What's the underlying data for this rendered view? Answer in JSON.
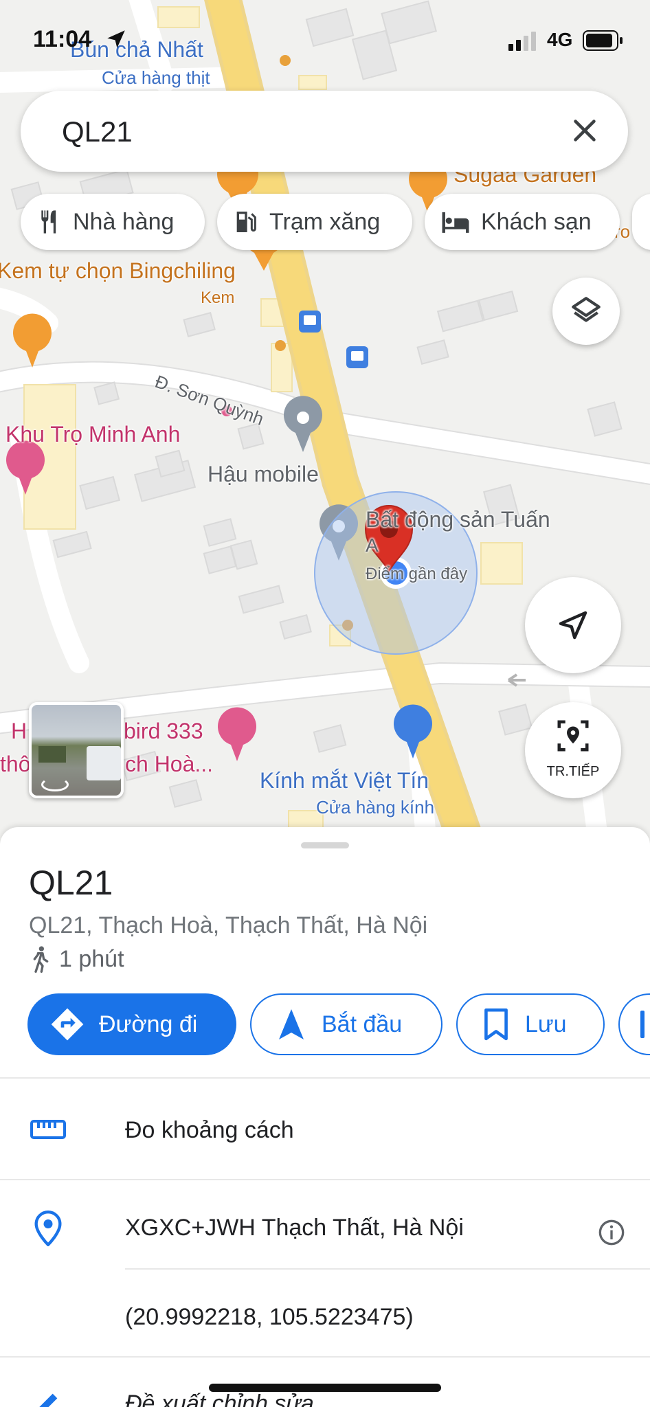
{
  "status_bar": {
    "time": "11:04",
    "network": "4G"
  },
  "search": {
    "query": "QL21"
  },
  "chips": [
    {
      "label": "Nhà hàng",
      "icon": "restaurant-icon"
    },
    {
      "label": "Trạm xăng",
      "icon": "gas-station-icon"
    },
    {
      "label": "Khách sạn",
      "icon": "hotel-icon"
    }
  ],
  "map": {
    "labels": {
      "bun_cha": "Bún chả Nhất",
      "bun_cha_sub": "Cửa hàng thịt",
      "sugaa": "Sugaa Garden",
      "kem": "Kem tự chọn Bingchiling",
      "kem_sub": "Kem",
      "son_quynh": "Đ. Sơn Quỳnh",
      "khu_tro": "Khu Trọ Minh Anh",
      "hau_mobile": "Hậu mobile",
      "bat_dong_san": "Bất động sản Tuấn",
      "bat_dong_san_2": "A",
      "gan_day": "Điểm gần đây",
      "hotel_left_1": "H",
      "hotel_left_1b": "bird 333",
      "hotel_left_2": "thô",
      "hotel_left_2b": "ch Hoà...",
      "kinh_mat": "Kính mắt Việt Tín",
      "kinh_mat_sub": "Cửa hàng kính",
      "ro_partial": "ro"
    },
    "live_button_label": "TR.TIẾP",
    "colors": {
      "road_major": "#f7d97a",
      "accent": "#1a73e8",
      "pin": "#d93025"
    }
  },
  "place": {
    "title": "QL21",
    "address": "QL21, Thạch Hoà, Thạch Thất, Hà Nội",
    "walk_time": "1 phút"
  },
  "actions": {
    "directions": "Đường đi",
    "start": "Bắt đầu",
    "save": "Lưu"
  },
  "rows": {
    "measure": "Đo khoảng cách",
    "plus_code": "XGXC+JWH Thạch Thất, Hà Nội",
    "coordinates": "(20.9992218, 105.5223475)",
    "suggest_edit": "Đề xuất chỉnh sửa"
  }
}
